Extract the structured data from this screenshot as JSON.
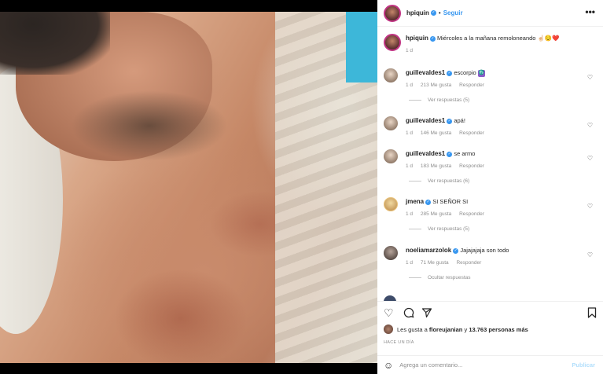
{
  "header": {
    "username": "hpiquin",
    "follow_label": "Seguir",
    "separator": "•",
    "more_icon": "more-horizontal-icon"
  },
  "caption": {
    "username": "hpiquin",
    "text": "Miércoles a la mañana remoloneando ☝🏻😌❤️",
    "time": "1 d"
  },
  "comments": [
    {
      "username": "guillevaldes1",
      "text": "escorpio",
      "badge": "♏",
      "time": "1 d",
      "likes": "213 Me gusta",
      "reply": "Responder",
      "view_replies": "Ver respuestas (5)"
    },
    {
      "username": "guillevaldes1",
      "text": "apá!",
      "time": "1 d",
      "likes": "146 Me gusta",
      "reply": "Responder"
    },
    {
      "username": "guillevaldes1",
      "text": "se armo",
      "time": "1 d",
      "likes": "183 Me gusta",
      "reply": "Responder",
      "view_replies": "Ver respuestas (6)"
    },
    {
      "username": "jmena",
      "text": "SI SEÑOR SI",
      "time": "1 d",
      "likes": "285 Me gusta",
      "reply": "Responder",
      "view_replies": "Ver respuestas (5)"
    },
    {
      "username": "noeliamarzolok",
      "text": "Jajajajaja son todo",
      "time": "1 d",
      "likes": "71 Me gusta",
      "reply": "Responder",
      "view_replies": "Ocultar respuestas"
    }
  ],
  "likes": {
    "prefix": "Les gusta a",
    "user": "floreujanian",
    "suffix": "y",
    "count": "13.763 personas más"
  },
  "time_ago": "HACE UN DÍA",
  "add_comment": {
    "placeholder": "Agrega un comentario...",
    "publish_label": "Publicar"
  }
}
